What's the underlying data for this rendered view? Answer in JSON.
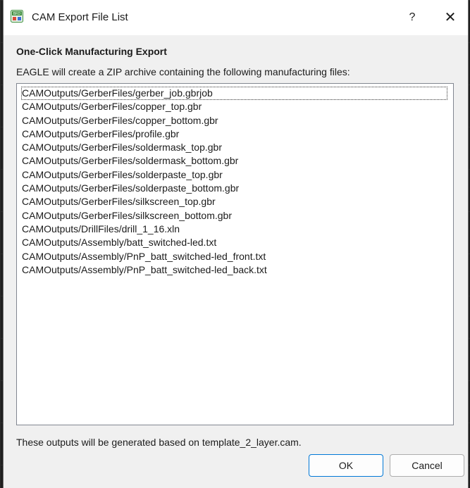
{
  "window": {
    "title": "CAM Export File List",
    "icon_text": "BRD",
    "help_label": "?",
    "close_label": "✕"
  },
  "heading": "One-Click Manufacturing Export",
  "description": "EAGLE will create a ZIP archive containing the following manufacturing files:",
  "files": [
    "CAMOutputs/GerberFiles/gerber_job.gbrjob",
    "CAMOutputs/GerberFiles/copper_top.gbr",
    "CAMOutputs/GerberFiles/copper_bottom.gbr",
    "CAMOutputs/GerberFiles/profile.gbr",
    "CAMOutputs/GerberFiles/soldermask_top.gbr",
    "CAMOutputs/GerberFiles/soldermask_bottom.gbr",
    "CAMOutputs/GerberFiles/solderpaste_top.gbr",
    "CAMOutputs/GerberFiles/solderpaste_bottom.gbr",
    "CAMOutputs/GerberFiles/silkscreen_top.gbr",
    "CAMOutputs/GerberFiles/silkscreen_bottom.gbr",
    "CAMOutputs/DrillFiles/drill_1_16.xln",
    "CAMOutputs/Assembly/batt_switched-led.txt",
    "CAMOutputs/Assembly/PnP_batt_switched-led_front.txt",
    "CAMOutputs/Assembly/PnP_batt_switched-led_back.txt"
  ],
  "footer": "These outputs will be generated based on template_2_layer.cam.",
  "buttons": {
    "ok": "OK",
    "cancel": "Cancel"
  },
  "colors": {
    "accent": "#0078d7",
    "dialog_bg": "#f0f0f0",
    "icon_bg": "#3a8d3a"
  }
}
